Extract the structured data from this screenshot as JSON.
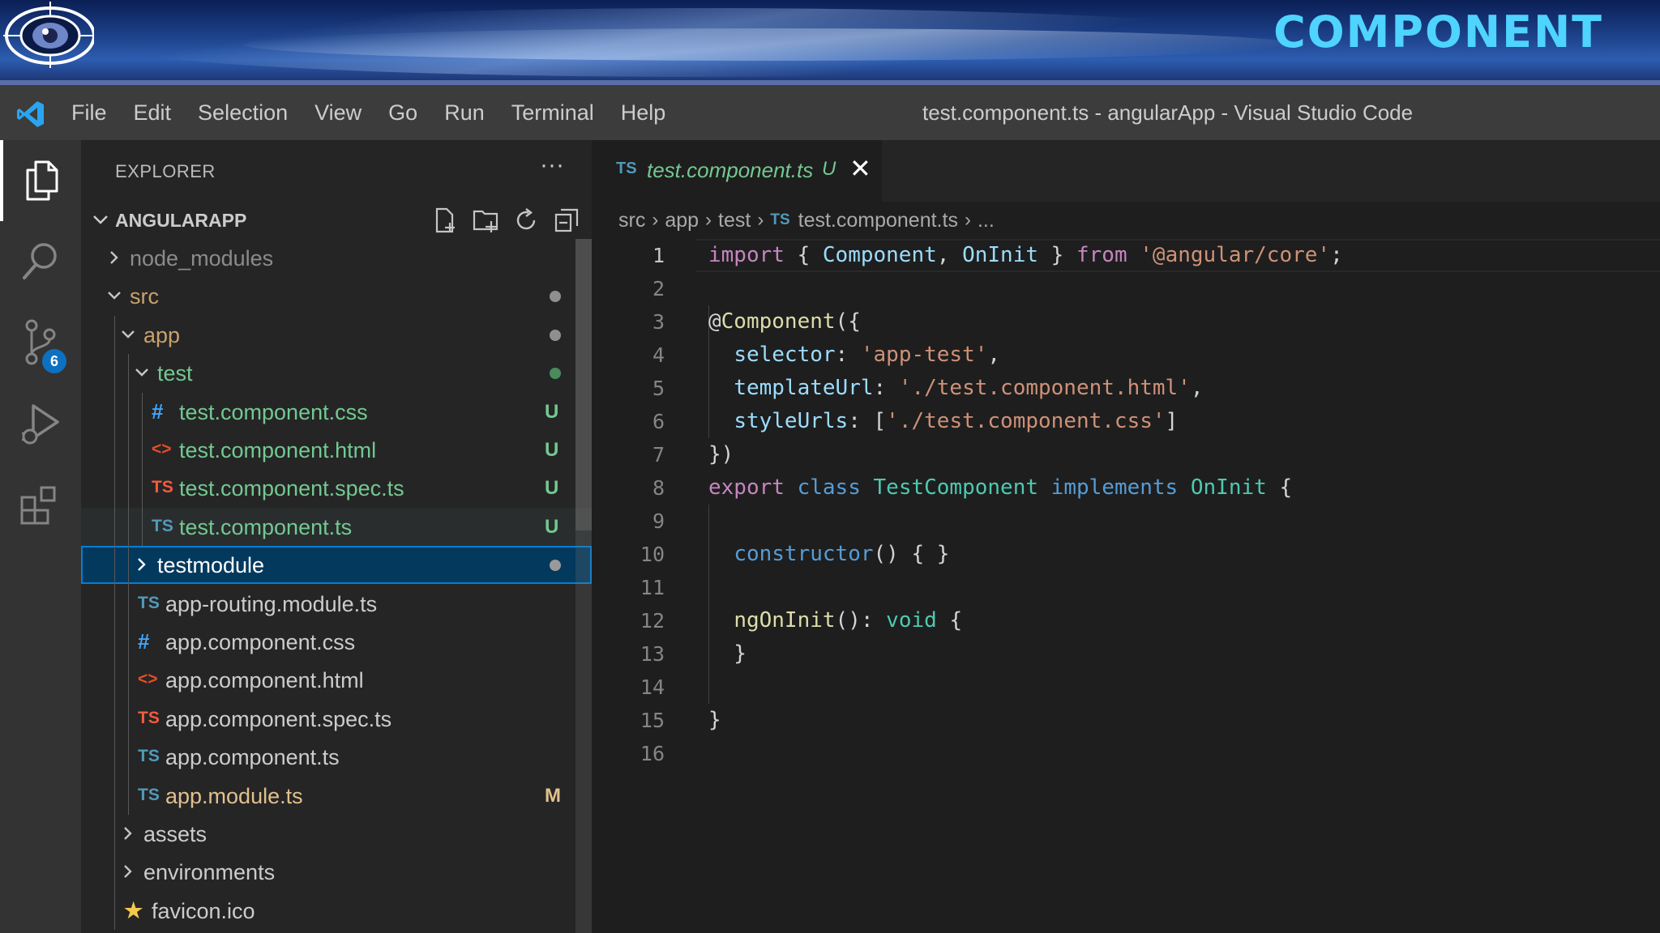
{
  "banner": {
    "title": "COMPONENT"
  },
  "menubar": {
    "items": [
      "File",
      "Edit",
      "Selection",
      "View",
      "Go",
      "Run",
      "Terminal",
      "Help"
    ],
    "window_title": "test.component.ts - angularApp - Visual Studio Code"
  },
  "activity": {
    "scm_badge": "6"
  },
  "explorer": {
    "title": "EXPLORER",
    "more": "···",
    "project": "ANGULARAPP",
    "rows": [
      {
        "label": "node_modules",
        "kind": "folder",
        "expanded": false,
        "depth": 1,
        "color": "#8b8b8b"
      },
      {
        "label": "src",
        "kind": "folder",
        "expanded": true,
        "depth": 1,
        "color": "#c9a26b",
        "deco": "dot",
        "deco_color": "#8f8f8f"
      },
      {
        "label": "app",
        "kind": "folder",
        "expanded": true,
        "depth": 2,
        "color": "#c9a26b",
        "deco": "dot",
        "deco_color": "#8f8f8f"
      },
      {
        "label": "test",
        "kind": "folder",
        "expanded": true,
        "depth": 3,
        "color": "#73c991",
        "deco": "dot",
        "deco_color": "#4a8b5c"
      },
      {
        "label": "test.component.css",
        "icon": "#",
        "icon_color": "#42a5f5",
        "depth": 4,
        "color": "#73c991",
        "deco": "U"
      },
      {
        "label": "test.component.html",
        "icon": "<>",
        "icon_color": "#e44d26",
        "depth": 4,
        "color": "#73c991",
        "deco": "U"
      },
      {
        "label": "test.component.spec.ts",
        "icon": "TS",
        "icon_color": "#f55a3c",
        "depth": 4,
        "color": "#73c991",
        "deco": "U"
      },
      {
        "label": "test.component.ts",
        "icon": "TS",
        "icon_color": "#519aba",
        "depth": 4,
        "color": "#73c991",
        "deco": "U"
      },
      {
        "label": "testmodule",
        "kind": "folder",
        "expanded": false,
        "depth": 3,
        "color": "#ffffff",
        "deco": "dot",
        "deco_color": "#9a9a9a"
      },
      {
        "label": "app-routing.module.ts",
        "icon": "TS",
        "icon_color": "#519aba",
        "depth": 3,
        "color": "#cccccc"
      },
      {
        "label": "app.component.css",
        "icon": "#",
        "icon_color": "#42a5f5",
        "depth": 3,
        "color": "#cccccc"
      },
      {
        "label": "app.component.html",
        "icon": "<>",
        "icon_color": "#e44d26",
        "depth": 3,
        "color": "#cccccc"
      },
      {
        "label": "app.component.spec.ts",
        "icon": "TS",
        "icon_color": "#f55a3c",
        "depth": 3,
        "color": "#cccccc"
      },
      {
        "label": "app.component.ts",
        "icon": "TS",
        "icon_color": "#519aba",
        "depth": 3,
        "color": "#cccccc"
      },
      {
        "label": "app.module.ts",
        "icon": "TS",
        "icon_color": "#519aba",
        "depth": 3,
        "color": "#e2c08d",
        "deco": "M"
      },
      {
        "label": "assets",
        "kind": "folder",
        "expanded": false,
        "depth": 2,
        "color": "#cccccc"
      },
      {
        "label": "environments",
        "kind": "folder",
        "expanded": false,
        "depth": 2,
        "color": "#cccccc"
      },
      {
        "label": "favicon.ico",
        "icon": "★",
        "icon_color": "#f2c94c",
        "depth": 2,
        "color": "#cccccc"
      }
    ]
  },
  "editor": {
    "tab": {
      "lang": "TS",
      "name": "test.component.ts",
      "status": "U",
      "close": "✕"
    },
    "breadcrumbs": [
      "src",
      "app",
      "test",
      "test.component.ts",
      "..."
    ],
    "breadcrumb_ts": "TS",
    "lines": [
      [
        [
          "import",
          "kw"
        ],
        [
          " { ",
          "plain"
        ],
        [
          "Component",
          "var"
        ],
        [
          ", ",
          "plain"
        ],
        [
          "OnInit",
          "var"
        ],
        [
          " } ",
          "plain"
        ],
        [
          "from",
          "kw"
        ],
        [
          " ",
          "plain"
        ],
        [
          "'@angular/core'",
          "str"
        ],
        [
          ";",
          "plain"
        ]
      ],
      [],
      [
        [
          "@",
          "plain"
        ],
        [
          "Component",
          "fn"
        ],
        [
          "({",
          "plain"
        ]
      ],
      [
        [
          "  ",
          "plain"
        ],
        [
          "selector",
          "var"
        ],
        [
          ": ",
          "plain"
        ],
        [
          "'app-test'",
          "str"
        ],
        [
          ",",
          "plain"
        ]
      ],
      [
        [
          "  ",
          "plain"
        ],
        [
          "templateUrl",
          "var"
        ],
        [
          ": ",
          "plain"
        ],
        [
          "'./test.component.html'",
          "str"
        ],
        [
          ",",
          "plain"
        ]
      ],
      [
        [
          "  ",
          "plain"
        ],
        [
          "styleUrls",
          "var"
        ],
        [
          ": [",
          "plain"
        ],
        [
          "'./test.component.css'",
          "str"
        ],
        [
          "]",
          "plain"
        ]
      ],
      [
        [
          "})",
          "plain"
        ]
      ],
      [
        [
          "export",
          "kw"
        ],
        [
          " ",
          "plain"
        ],
        [
          "class",
          "kb"
        ],
        [
          " ",
          "plain"
        ],
        [
          "TestComponent",
          "cls"
        ],
        [
          " ",
          "plain"
        ],
        [
          "implements",
          "kb"
        ],
        [
          " ",
          "plain"
        ],
        [
          "OnInit",
          "cls"
        ],
        [
          " {",
          "plain"
        ]
      ],
      [],
      [
        [
          "  ",
          "plain"
        ],
        [
          "constructor",
          "kb"
        ],
        [
          "() { }",
          "plain"
        ]
      ],
      [],
      [
        [
          "  ",
          "plain"
        ],
        [
          "ngOnInit",
          "fn"
        ],
        [
          "(): ",
          "plain"
        ],
        [
          "void",
          "cls"
        ],
        [
          " {",
          "plain"
        ]
      ],
      [
        [
          "  }",
          "plain"
        ]
      ],
      [],
      [
        [
          "}",
          "plain"
        ]
      ],
      []
    ]
  }
}
